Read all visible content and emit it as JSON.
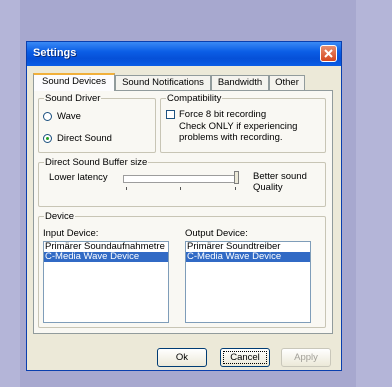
{
  "window": {
    "title": "Settings",
    "close_icon": "close-icon"
  },
  "tabs": [
    "Sound Devices",
    "Sound Notifications",
    "Bandwidth",
    "Other"
  ],
  "sound_driver": {
    "label": "Sound Driver",
    "options": [
      "Wave",
      "Direct Sound"
    ],
    "selected": "Direct Sound"
  },
  "compatibility": {
    "label": "Compatibility",
    "checkbox_label": "Force 8 bit recording",
    "checked": false,
    "note_line1": "Check ONLY if experiencing",
    "note_line2": "problems with recording."
  },
  "buffer": {
    "label": "Direct Sound Buffer size",
    "left_label": "Lower latency",
    "right_label_line1": "Better sound",
    "right_label_line2": "Quality",
    "value_fraction": 1.0
  },
  "device": {
    "label": "Device",
    "input_label": "Input Device:",
    "output_label": "Output Device:",
    "input_items": [
      "Primärer Soundaufnahmetre",
      "C-Media Wave Device"
    ],
    "input_selected": 1,
    "output_items": [
      "Primärer Soundtreiber",
      "C-Media Wave Device"
    ],
    "output_selected": 1
  },
  "buttons": {
    "ok": "Ok",
    "cancel": "Cancel",
    "apply": "Apply"
  }
}
